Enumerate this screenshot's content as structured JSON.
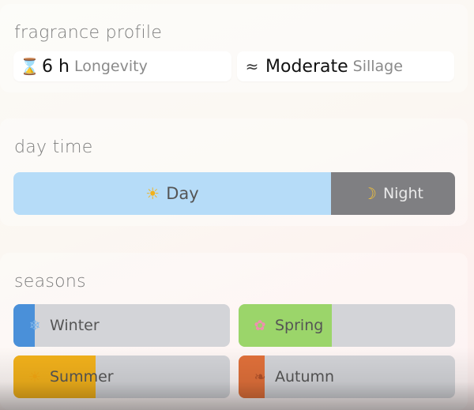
{
  "profile": {
    "title": "fragrance profile",
    "longevity": {
      "icon": "hourglass-icon",
      "glyph": "⌛",
      "value": "6 h",
      "label": "Longevity"
    },
    "sillage": {
      "icon": "wave-icon",
      "glyph": "≈",
      "value": "Moderate",
      "label": "Sillage"
    }
  },
  "daytime": {
    "title": "day time",
    "day": {
      "icon": "sun-icon",
      "glyph": "☀",
      "label": "Day",
      "selected": true
    },
    "night": {
      "icon": "moon-icon",
      "glyph": "☽",
      "label": "Night",
      "selected": false
    }
  },
  "seasons": {
    "title": "seasons",
    "items": [
      {
        "label": "Winter",
        "icon": "snowflake-icon",
        "glyph": "❄",
        "fill_fraction": 0.1,
        "color": "#4a90d9"
      },
      {
        "label": "Spring",
        "icon": "flower-icon",
        "glyph": "✿",
        "fill_fraction": 0.43,
        "color": "#9bd56a"
      },
      {
        "label": "Summer",
        "icon": "sun-icon",
        "glyph": "☀",
        "fill_fraction": 0.38,
        "color": "#f2b11b"
      },
      {
        "label": "Autumn",
        "icon": "leaf-icon",
        "glyph": "❧",
        "fill_fraction": 0.12,
        "color": "#e0703a"
      }
    ]
  },
  "colors": {
    "day_active": "#b6dcf8",
    "night_inactive": "#7f7f82",
    "bar_track": "#d3d4d8"
  }
}
